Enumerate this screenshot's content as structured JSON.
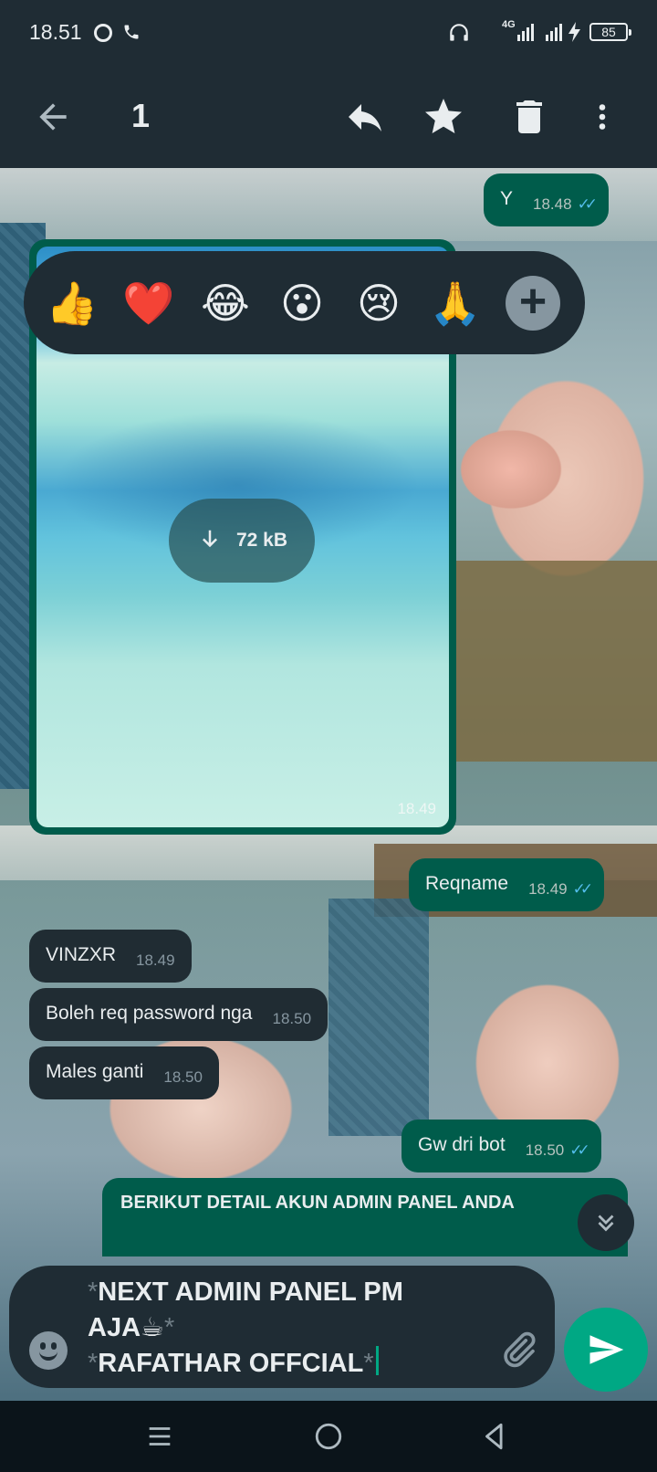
{
  "status_bar": {
    "time": "18.51",
    "network_label": "4G",
    "battery": "85"
  },
  "action_bar": {
    "selected_count": "1",
    "icons": [
      "back-arrow-icon",
      "reply-icon",
      "star-icon",
      "delete-icon",
      "more-vert-icon"
    ]
  },
  "reactions": {
    "emojis": [
      "👍",
      "❤️",
      "😂",
      "😮",
      "😢",
      "🙏"
    ],
    "more_icon": "plus-icon"
  },
  "messages": [
    {
      "dir": "out",
      "text": "Y",
      "time": "18.48",
      "read": true
    },
    {
      "dir": "out",
      "type": "image",
      "download_size": "72 kB",
      "time": "18.49"
    },
    {
      "dir": "out",
      "text": "Reqname",
      "time": "18.49",
      "read": true
    },
    {
      "dir": "in",
      "text": "VINZXR",
      "time": "18.49"
    },
    {
      "dir": "in",
      "text": "Boleh req password nga",
      "time": "18.50"
    },
    {
      "dir": "in",
      "text": "Males ganti",
      "time": "18.50"
    },
    {
      "dir": "out",
      "text": "Gw dri bot",
      "time": "18.50",
      "read": true
    },
    {
      "dir": "out",
      "text": "BERIKUT DETAIL AKUN ADMIN  PANEL ANDA",
      "partial": true
    }
  ],
  "composer": {
    "line1_ast": "*",
    "line1": "NEXT ADMIN PANEL PM",
    "line2": "AJA☕",
    "line2_ast": "*",
    "line3_ast_open": "*",
    "line3": "RAFATHAR OFFCIAL",
    "line3_ast_close": "*"
  },
  "colors": {
    "outgoing_bubble": "#005c4b",
    "incoming_bubble": "#202c33",
    "accent": "#00a884",
    "read_ticks": "#53bdeb"
  }
}
